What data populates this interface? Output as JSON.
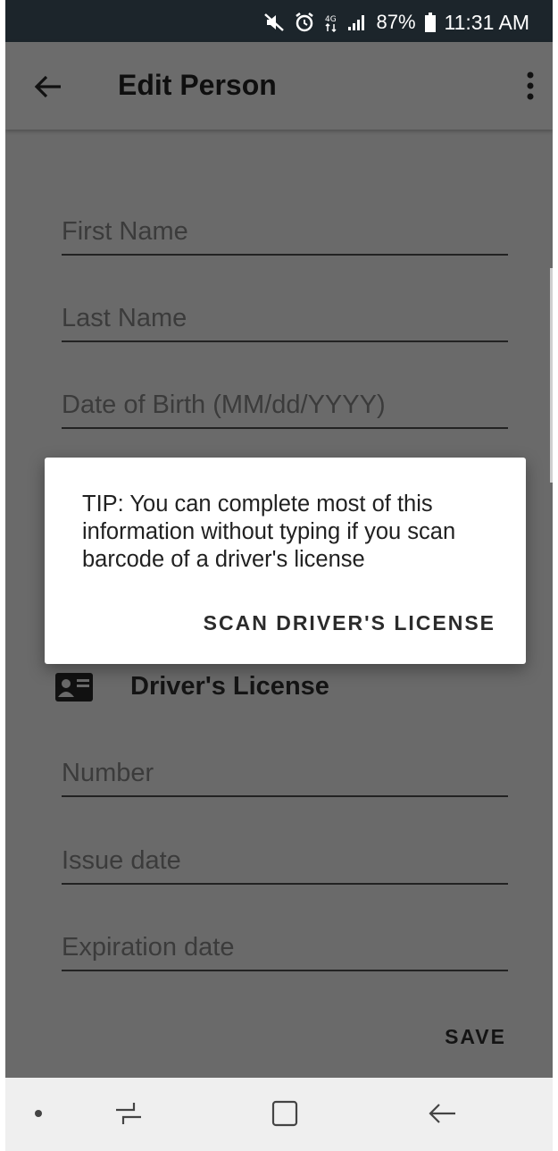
{
  "status_bar": {
    "battery": "87%",
    "time": "11:31 AM",
    "icons": [
      "mute-icon",
      "alarm-icon",
      "data-icon",
      "signal-icon",
      "battery-icon"
    ]
  },
  "app_bar": {
    "title": "Edit Person",
    "icons": [
      "back-arrow-icon",
      "more-vert-icon"
    ]
  },
  "form": {
    "first_name": {
      "placeholder": "First Name",
      "value": ""
    },
    "last_name": {
      "placeholder": "Last Name",
      "value": ""
    },
    "dob": {
      "placeholder": "Date of Birth (MM/dd/YYYY)",
      "value": ""
    },
    "drivers_license": {
      "title": "Driver's License",
      "icon": "id-card-icon",
      "number": {
        "placeholder": "Number",
        "value": ""
      },
      "issue_date": {
        "placeholder": "Issue date",
        "value": ""
      },
      "expiration_date": {
        "placeholder": "Expiration date",
        "value": ""
      }
    },
    "save_label": "SAVE"
  },
  "dialog": {
    "message": "TIP: You can complete most of this information without typing if you scan barcode of a driver's license",
    "action_label": "SCAN DRIVER'S LICENSE"
  },
  "nav_bar": {
    "icons": [
      "nav-dot-icon",
      "recents-icon",
      "home-icon",
      "back-icon"
    ]
  },
  "colors": {
    "status_bar": "#1c252b",
    "scrim_background": "#6a6a6a",
    "dialog_background": "#ffffff",
    "nav_bar": "#efefef"
  }
}
